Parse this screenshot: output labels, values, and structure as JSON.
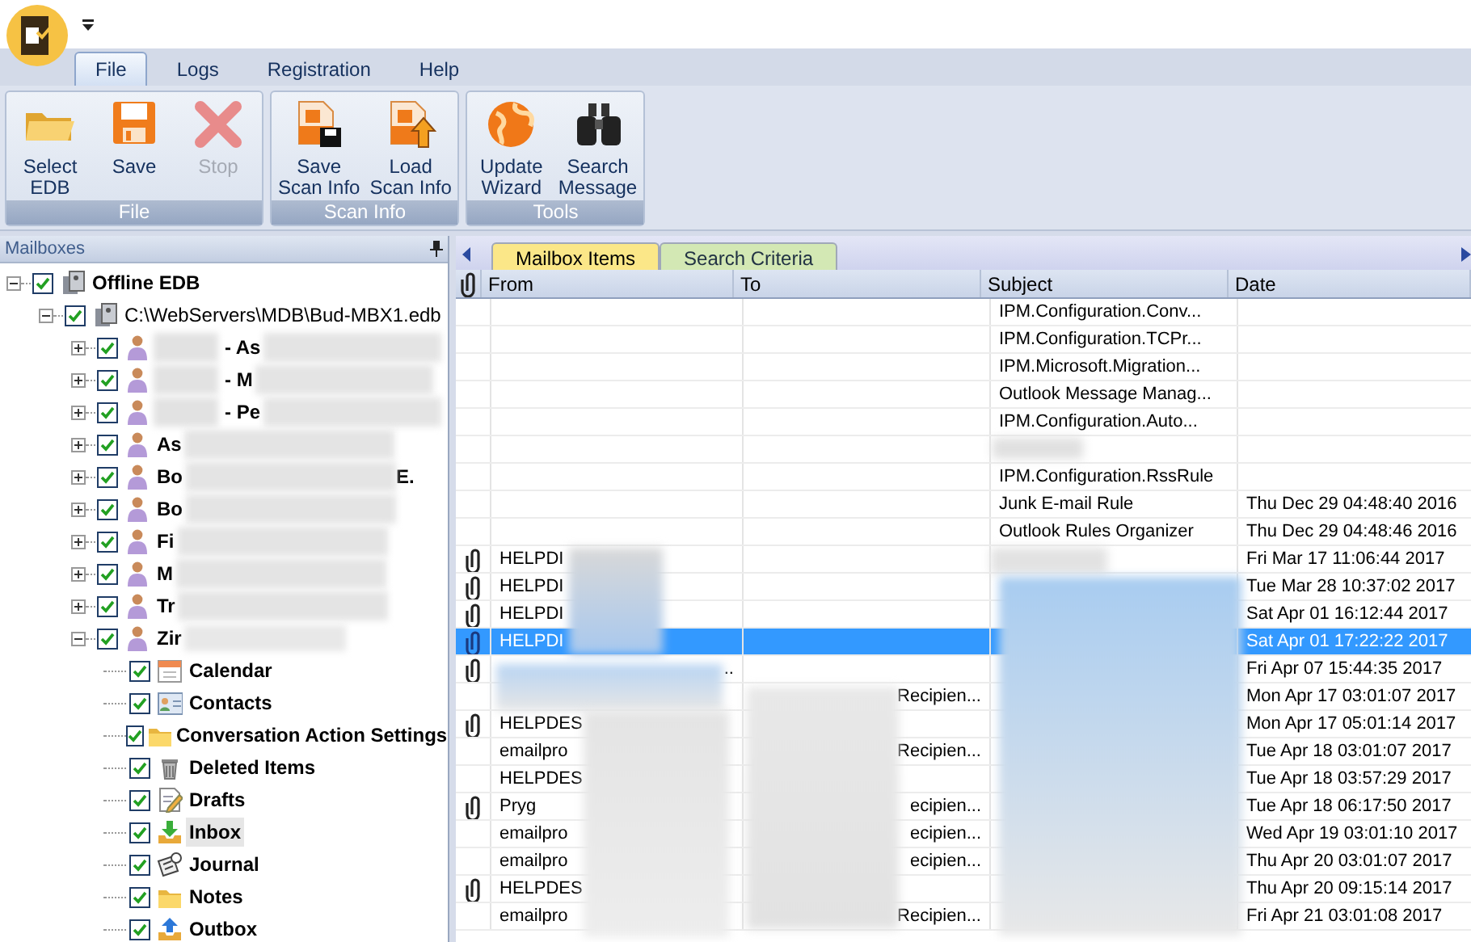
{
  "menu_tabs": [
    {
      "label": "File",
      "selected": true
    },
    {
      "label": "Logs",
      "selected": false
    },
    {
      "label": "Registration",
      "selected": false
    },
    {
      "label": "Help",
      "selected": false
    }
  ],
  "ribbon_groups": [
    {
      "label": "File",
      "buttons": [
        {
          "label": "Select\nEDB",
          "kind": "open",
          "disabled": false
        },
        {
          "label": "Save",
          "kind": "save",
          "disabled": false
        },
        {
          "label": "Stop",
          "kind": "stop",
          "disabled": true
        }
      ]
    },
    {
      "label": "Scan Info",
      "buttons": [
        {
          "label": "Save\nScan Info",
          "kind": "save_scan",
          "disabled": false
        },
        {
          "label": "Load\nScan Info",
          "kind": "load_scan",
          "disabled": false
        }
      ]
    },
    {
      "label": "Tools",
      "buttons": [
        {
          "label": "Update\nWizard",
          "kind": "globe",
          "disabled": false
        },
        {
          "label": "Search\nMessage",
          "kind": "binoculars",
          "disabled": false
        }
      ]
    }
  ],
  "mailboxes_pane": {
    "title": "Mailboxes",
    "tree": [
      {
        "label": "Offline EDB",
        "kind": "store",
        "bold": true,
        "checked": true,
        "expanded": true,
        "selected": false,
        "children": [
          {
            "label": "C:\\WebServers\\MDB\\Bud-MBX1.edb",
            "kind": "store",
            "bold": false,
            "checked": true,
            "expanded": true,
            "selected": false,
            "children": [
              {
                "label": "- As",
                "kind": "mailbox",
                "bold": true,
                "checked": true,
                "expanded": false,
                "selected": false,
                "redacted_prefix": true
              },
              {
                "label": "- M",
                "kind": "mailbox",
                "bold": true,
                "checked": true,
                "expanded": false,
                "selected": false,
                "redacted_prefix": true
              },
              {
                "label": "- Pe",
                "kind": "mailbox",
                "bold": true,
                "checked": true,
                "expanded": false,
                "selected": false,
                "redacted_prefix": true
              },
              {
                "label": "As",
                "kind": "mailbox",
                "bold": true,
                "checked": true,
                "expanded": false,
                "selected": false,
                "redacted_prefix": false
              },
              {
                "label": "Bo",
                "tail": "E.",
                "kind": "mailbox",
                "bold": true,
                "checked": true,
                "expanded": false,
                "selected": false,
                "redacted_prefix": false
              },
              {
                "label": "Bo",
                "kind": "mailbox",
                "bold": true,
                "checked": true,
                "expanded": false,
                "selected": false,
                "redacted_prefix": false
              },
              {
                "label": "Fi",
                "kind": "mailbox",
                "bold": true,
                "checked": true,
                "expanded": false,
                "selected": false,
                "redacted_prefix": false
              },
              {
                "label": "M",
                "kind": "mailbox",
                "bold": true,
                "checked": true,
                "expanded": false,
                "selected": false,
                "redacted_prefix": false
              },
              {
                "label": "Tr",
                "kind": "mailbox",
                "bold": true,
                "checked": true,
                "expanded": false,
                "selected": false,
                "redacted_prefix": false
              },
              {
                "label": "Zir",
                "kind": "mailbox",
                "bold": true,
                "checked": true,
                "expanded": true,
                "selected": false,
                "redacted_prefix": false,
                "children": [
                  {
                    "label": "Calendar",
                    "kind": "calendar",
                    "bold": true,
                    "checked": true,
                    "selected": false
                  },
                  {
                    "label": "Contacts",
                    "kind": "contacts",
                    "bold": true,
                    "checked": true,
                    "selected": false
                  },
                  {
                    "label": "Conversation Action Settings",
                    "kind": "folder",
                    "bold": true,
                    "checked": true,
                    "selected": false
                  },
                  {
                    "label": "Deleted Items",
                    "kind": "trash",
                    "bold": true,
                    "checked": true,
                    "selected": false
                  },
                  {
                    "label": "Drafts",
                    "kind": "drafts",
                    "bold": true,
                    "checked": true,
                    "selected": false
                  },
                  {
                    "label": "Inbox",
                    "kind": "inbox",
                    "bold": true,
                    "checked": true,
                    "selected": true
                  },
                  {
                    "label": "Journal",
                    "kind": "journal",
                    "bold": true,
                    "checked": true,
                    "selected": false
                  },
                  {
                    "label": "Notes",
                    "kind": "folder",
                    "bold": true,
                    "checked": true,
                    "selected": false
                  },
                  {
                    "label": "Outbox",
                    "kind": "outbox",
                    "bold": true,
                    "checked": true,
                    "selected": false
                  }
                ]
              }
            ]
          }
        ]
      }
    ]
  },
  "view_tabs": [
    {
      "label": "Mailbox Items",
      "selected": true,
      "color": "#fbe788"
    },
    {
      "label": "Search Criteria",
      "selected": false,
      "color": "#d3e8b4"
    }
  ],
  "table": {
    "columns": [
      "From",
      "To",
      "Subject",
      "Date"
    ],
    "rows": [
      {
        "attachment": false,
        "from": "",
        "to": "",
        "subject": "IPM.Configuration.Conv...",
        "date": "",
        "selected": false
      },
      {
        "attachment": false,
        "from": "",
        "to": "",
        "subject": "IPM.Configuration.TCPr...",
        "date": "",
        "selected": false
      },
      {
        "attachment": false,
        "from": "",
        "to": "",
        "subject": "IPM.Microsoft.Migration...",
        "date": "",
        "selected": false
      },
      {
        "attachment": false,
        "from": "",
        "to": "",
        "subject": "Outlook Message Manag...",
        "date": "",
        "selected": false
      },
      {
        "attachment": false,
        "from": "",
        "to": "",
        "subject": "IPM.Configuration.Auto...",
        "date": "",
        "selected": false
      },
      {
        "attachment": false,
        "from": "",
        "to": "",
        "subject": "",
        "date": "",
        "selected": false
      },
      {
        "attachment": false,
        "from": "",
        "to": "",
        "subject": "IPM.Configuration.RssRule",
        "date": "",
        "selected": false
      },
      {
        "attachment": false,
        "from": "",
        "to": "",
        "subject": "Junk E-mail Rule",
        "date": "Thu Dec 29 04:48:40 2016",
        "selected": false
      },
      {
        "attachment": false,
        "from": "",
        "to": "",
        "subject": "Outlook Rules Organizer",
        "date": "Thu Dec 29 04:48:46 2016",
        "selected": false
      },
      {
        "attachment": true,
        "from": "HELPDI",
        "to": "",
        "subject": "",
        "date": "Fri Mar 17 11:06:44 2017",
        "selected": false
      },
      {
        "attachment": true,
        "from": "HELPDI",
        "to": "",
        "subject": "",
        "date": "Tue Mar 28 10:37:02 2017",
        "selected": false
      },
      {
        "attachment": true,
        "from": "HELPDI",
        "to": "",
        "subject": "",
        "date": "Sat Apr 01 16:12:44 2017",
        "selected": false
      },
      {
        "attachment": true,
        "from": "HELPDI",
        "to": "",
        "subject": "",
        "date": "Sat Apr 01 17:22:22 2017",
        "selected": true
      },
      {
        "attachment": true,
        "from": "..",
        "to": "",
        "subject": "",
        "date": "Fri Apr 07 15:44:35 2017",
        "selected": false
      },
      {
        "attachment": false,
        "from": "",
        "to": "Recipien...",
        "subject": "",
        "date": "Mon Apr 17 03:01:07 2017",
        "selected": false
      },
      {
        "attachment": true,
        "from": "HELPDES",
        "to": "",
        "subject": "",
        "date": "Mon Apr 17 05:01:14 2017",
        "selected": false
      },
      {
        "attachment": false,
        "from": "emailpro",
        "to": "Recipien...",
        "subject": "",
        "date": "Tue Apr 18 03:01:07 2017",
        "selected": false
      },
      {
        "attachment": false,
        "from": "HELPDES",
        "to": "",
        "subject": "",
        "date": "Tue Apr 18 03:57:29 2017",
        "selected": false
      },
      {
        "attachment": true,
        "from": "Pryg",
        "to": "ecipien...",
        "subject": "",
        "date": "Tue Apr 18 06:17:50 2017",
        "selected": false
      },
      {
        "attachment": false,
        "from": "emailpro",
        "to": "ecipien...",
        "subject": "",
        "date": "Wed Apr 19 03:01:10 2017",
        "selected": false
      },
      {
        "attachment": false,
        "from": "emailpro",
        "to": "ecipien...",
        "subject": "",
        "date": "Thu Apr 20 03:01:07 2017",
        "selected": false
      },
      {
        "attachment": true,
        "from": "HELPDES",
        "to": "",
        "subject": "",
        "date": "Thu Apr 20 09:15:14 2017",
        "selected": false
      },
      {
        "attachment": false,
        "from": "emailpro",
        "to": "Recipien...",
        "subject": "",
        "date": "Fri Apr 21 03:01:08 2017",
        "selected": false
      }
    ]
  }
}
